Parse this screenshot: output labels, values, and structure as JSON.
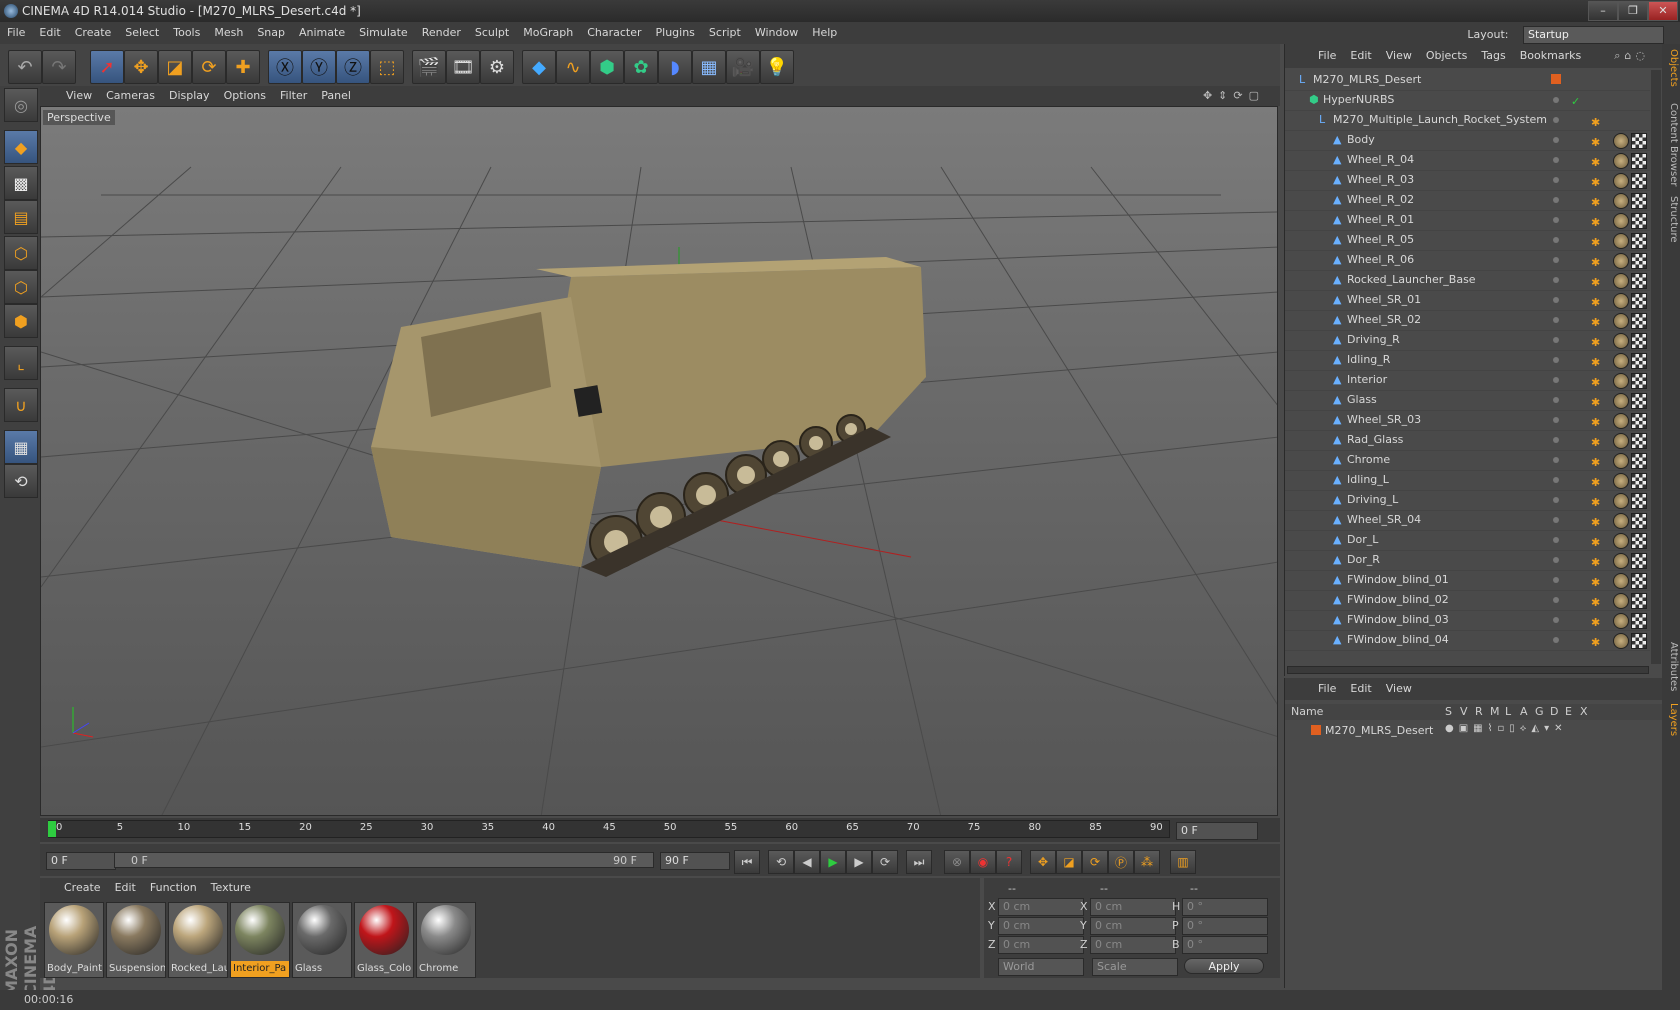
{
  "window": {
    "title": "CINEMA 4D R14.014 Studio - [M270_MLRS_Desert.c4d *]",
    "min": "–",
    "max": "❐",
    "close": "✕"
  },
  "menubar": [
    "File",
    "Edit",
    "Create",
    "Select",
    "Tools",
    "Mesh",
    "Snap",
    "Animate",
    "Simulate",
    "Render",
    "Sculpt",
    "MoGraph",
    "Character",
    "Plugins",
    "Script",
    "Window",
    "Help"
  ],
  "layout": {
    "label": "Layout:",
    "value": "Startup"
  },
  "viewport": {
    "menu": [
      "View",
      "Cameras",
      "Display",
      "Options",
      "Filter",
      "Panel"
    ],
    "label": "Perspective"
  },
  "timeline": {
    "ticks": [
      "0",
      "5",
      "10",
      "15",
      "20",
      "25",
      "30",
      "35",
      "40",
      "45",
      "50",
      "55",
      "60",
      "65",
      "70",
      "75",
      "80",
      "85",
      "90"
    ],
    "current": "0 F",
    "start": "0 F",
    "range_start": "0 F",
    "range_end": "90 F",
    "end": "90 F"
  },
  "materials": {
    "menu": [
      "Create",
      "Edit",
      "Function",
      "Texture"
    ],
    "items": [
      {
        "name": "Body_Paint",
        "color": "#b8a278"
      },
      {
        "name": "Suspension",
        "color": "#8a7a60"
      },
      {
        "name": "Rocked_Lau",
        "color": "#bca67c"
      },
      {
        "name": "Interior_Pa",
        "color": "#7d8560"
      },
      {
        "name": "Glass",
        "color": "#6a6a6a"
      },
      {
        "name": "Glass_Colo",
        "color": "#c0151a"
      },
      {
        "name": "Chrome",
        "color": "#8a8a8a"
      }
    ]
  },
  "coords": {
    "headers": [
      "--",
      "--",
      "--"
    ],
    "rows": [
      {
        "a": "X",
        "av": "0 cm",
        "b": "X",
        "bv": "0 cm",
        "c": "H",
        "cv": "0 °"
      },
      {
        "a": "Y",
        "av": "0 cm",
        "b": "Y",
        "bv": "0 cm",
        "c": "P",
        "cv": "0 °"
      },
      {
        "a": "Z",
        "av": "0 cm",
        "b": "Z",
        "bv": "0 cm",
        "c": "B",
        "cv": "0 °"
      }
    ],
    "world": "World",
    "scale": "Scale",
    "apply": "Apply"
  },
  "status": {
    "time": "00:00:16"
  },
  "objects": {
    "menu": [
      "File",
      "Edit",
      "View",
      "Objects",
      "Tags",
      "Bookmarks"
    ],
    "root": "M270_MLRS_Desert",
    "hypernurbs": "HyperNURBS",
    "group": "M270_Multiple_Launch_Rocket_System",
    "children": [
      "Body",
      "Wheel_R_04",
      "Wheel_R_03",
      "Wheel_R_02",
      "Wheel_R_01",
      "Wheel_R_05",
      "Wheel_R_06",
      "Rocked_Launcher_Base",
      "Wheel_SR_01",
      "Wheel_SR_02",
      "Driving_R",
      "Idling_R",
      "Interior",
      "Glass",
      "Wheel_SR_03",
      "Rad_Glass",
      "Chrome",
      "Idling_L",
      "Driving_L",
      "Wheel_SR_04",
      "Dor_L",
      "Dor_R",
      "FWindow_blind_01",
      "FWindow_blind_02",
      "FWindow_blind_03",
      "FWindow_blind_04"
    ]
  },
  "layers": {
    "menu": [
      "File",
      "Edit",
      "View"
    ],
    "columns": [
      "Name",
      "S",
      "V",
      "R",
      "M",
      "L",
      "A",
      "G",
      "D",
      "E",
      "X"
    ],
    "items": [
      "M270_MLRS_Desert"
    ]
  },
  "sidetabs": [
    "Objects",
    "Content Browser",
    "Structure",
    "Attributes",
    "Layers"
  ]
}
